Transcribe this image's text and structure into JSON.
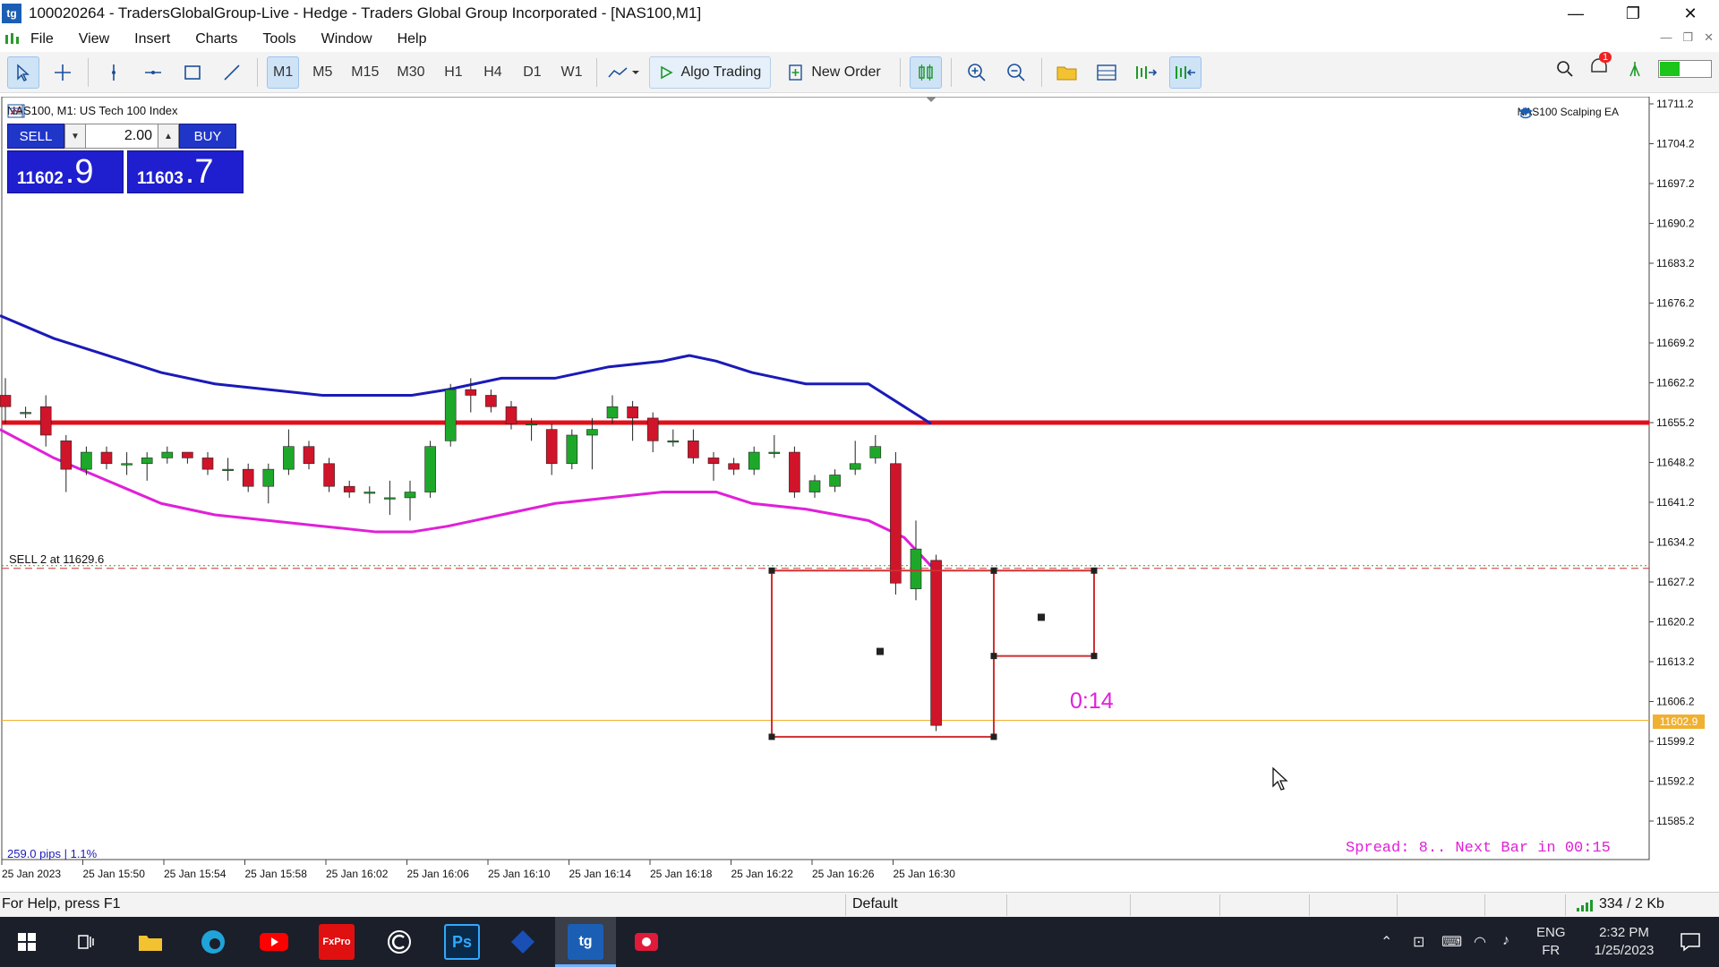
{
  "window": {
    "title": "100020264 - TradersGlobalGroup-Live - Hedge - Traders Global Group Incorporated - [NAS100,M1]",
    "logo_text": "tg",
    "minimize": "—",
    "restore": "❐",
    "close": "✕"
  },
  "menu": {
    "items": [
      "File",
      "View",
      "Insert",
      "Charts",
      "Tools",
      "Window",
      "Help"
    ]
  },
  "toolbar": {
    "timeframes": [
      "M1",
      "M5",
      "M15",
      "M30",
      "H1",
      "H4",
      "D1",
      "W1"
    ],
    "active_timeframe": "M1",
    "algo_trading": "Algo Trading",
    "new_order": "New Order",
    "notification_count": "1"
  },
  "chart": {
    "symbol_header": "NAS100, M1:  US Tech 100 Index",
    "ea_name": "NAS100 Scalping EA",
    "order_line_label": "SELL 2 at 11629.6",
    "countdown": "0:14",
    "pips_label": "259.0 pips | 1.1%",
    "spread_text": "Spread: 8.. Next Bar in 00:15",
    "current_price_label": "11602.9",
    "colors": {
      "up_candle": "#1ea82a",
      "down_candle": "#d0142a",
      "upper_band": "#1a1ab8",
      "lower_band": "#e020d8",
      "horizontal_line": "#e0101a",
      "rectangle": "#d03030",
      "bid_line": "#f0b030",
      "countdown": "#e020d8"
    }
  },
  "trade_panel": {
    "sell_label": "SELL",
    "buy_label": "BUY",
    "lot": "2.00",
    "bid_big": "11602",
    "bid_huge": ".9",
    "ask_big": "11603",
    "ask_huge": ".7"
  },
  "chart_data": {
    "type": "candlestick",
    "y_ticks": [
      "11711.2",
      "11704.2",
      "11697.2",
      "11690.2",
      "11683.2",
      "11676.2",
      "11669.2",
      "11662.2",
      "11655.2",
      "11648.2",
      "11641.2",
      "11634.2",
      "11627.2",
      "11620.2",
      "11613.2",
      "11606.2",
      "11599.2",
      "11592.2",
      "11585.2"
    ],
    "x_ticks": [
      "25 Jan 2023",
      "25 Jan 15:50",
      "25 Jan 15:54",
      "25 Jan 15:58",
      "25 Jan 16:02",
      "25 Jan 16:06",
      "25 Jan 16:10",
      "25 Jan 16:14",
      "25 Jan 16:18",
      "25 Jan 16:22",
      "25 Jan 16:26",
      "25 Jan 16:30"
    ],
    "ylim": [
      11580,
      11715
    ],
    "horizontal_line": 11655.2,
    "sell_order_level": 11629.6,
    "bid": 11602.9,
    "candles": [
      {
        "o": 11660,
        "c": 11658,
        "h": 11663,
        "l": 11655
      },
      {
        "o": 11657,
        "c": 11657,
        "h": 11658,
        "l": 11656
      },
      {
        "o": 11658,
        "c": 11653,
        "h": 11660,
        "l": 11651
      },
      {
        "o": 11652,
        "c": 11647,
        "h": 11653,
        "l": 11643
      },
      {
        "o": 11647,
        "c": 11650,
        "h": 11651,
        "l": 11646
      },
      {
        "o": 11650,
        "c": 11648,
        "h": 11651,
        "l": 11647
      },
      {
        "o": 11648,
        "c": 11648,
        "h": 11650,
        "l": 11646
      },
      {
        "o": 11648,
        "c": 11649,
        "h": 11650,
        "l": 11645
      },
      {
        "o": 11649,
        "c": 11650,
        "h": 11651,
        "l": 11648
      },
      {
        "o": 11650,
        "c": 11649,
        "h": 11650,
        "l": 11648
      },
      {
        "o": 11649,
        "c": 11647,
        "h": 11650,
        "l": 11646
      },
      {
        "o": 11647,
        "c": 11647,
        "h": 11649,
        "l": 11645
      },
      {
        "o": 11647,
        "c": 11644,
        "h": 11648,
        "l": 11643
      },
      {
        "o": 11644,
        "c": 11647,
        "h": 11648,
        "l": 11641
      },
      {
        "o": 11647,
        "c": 11651,
        "h": 11654,
        "l": 11646
      },
      {
        "o": 11651,
        "c": 11648,
        "h": 11652,
        "l": 11647
      },
      {
        "o": 11648,
        "c": 11644,
        "h": 11649,
        "l": 11643
      },
      {
        "o": 11644,
        "c": 11643,
        "h": 11645,
        "l": 11642
      },
      {
        "o": 11643,
        "c": 11643,
        "h": 11644,
        "l": 11641
      },
      {
        "o": 11642,
        "c": 11642,
        "h": 11645,
        "l": 11639
      },
      {
        "o": 11642,
        "c": 11643,
        "h": 11645,
        "l": 11638
      },
      {
        "o": 11643,
        "c": 11651,
        "h": 11652,
        "l": 11642
      },
      {
        "o": 11652,
        "c": 11661,
        "h": 11662,
        "l": 11651
      },
      {
        "o": 11661,
        "c": 11660,
        "h": 11663,
        "l": 11657
      },
      {
        "o": 11660,
        "c": 11658,
        "h": 11661,
        "l": 11657
      },
      {
        "o": 11658,
        "c": 11655,
        "h": 11659,
        "l": 11654
      },
      {
        "o": 11655,
        "c": 11655,
        "h": 11656,
        "l": 11652
      },
      {
        "o": 11654,
        "c": 11648,
        "h": 11655,
        "l": 11646
      },
      {
        "o": 11648,
        "c": 11653,
        "h": 11654,
        "l": 11647
      },
      {
        "o": 11653,
        "c": 11654,
        "h": 11656,
        "l": 11647
      },
      {
        "o": 11656,
        "c": 11658,
        "h": 11660,
        "l": 11655
      },
      {
        "o": 11658,
        "c": 11656,
        "h": 11659,
        "l": 11652
      },
      {
        "o": 11656,
        "c": 11652,
        "h": 11657,
        "l": 11650
      },
      {
        "o": 11652,
        "c": 11652,
        "h": 11654,
        "l": 11651
      },
      {
        "o": 11652,
        "c": 11649,
        "h": 11654,
        "l": 11648
      },
      {
        "o": 11649,
        "c": 11648,
        "h": 11650,
        "l": 11645
      },
      {
        "o": 11648,
        "c": 11647,
        "h": 11649,
        "l": 11646
      },
      {
        "o": 11647,
        "c": 11650,
        "h": 11651,
        "l": 11646
      },
      {
        "o": 11650,
        "c": 11650,
        "h": 11653,
        "l": 11649
      },
      {
        "o": 11650,
        "c": 11643,
        "h": 11651,
        "l": 11642
      },
      {
        "o": 11643,
        "c": 11645,
        "h": 11646,
        "l": 11642
      },
      {
        "o": 11644,
        "c": 11646,
        "h": 11647,
        "l": 11643
      },
      {
        "o": 11647,
        "c": 11648,
        "h": 11652,
        "l": 11646
      },
      {
        "o": 11649,
        "c": 11651,
        "h": 11653,
        "l": 11648
      },
      {
        "o": 11648,
        "c": 11627,
        "h": 11650,
        "l": 11625
      },
      {
        "o": 11626,
        "c": 11633,
        "h": 11638,
        "l": 11624
      },
      {
        "o": 11631,
        "c": 11602,
        "h": 11632,
        "l": 11601
      }
    ],
    "upper_band": [
      [
        0,
        11674
      ],
      [
        60,
        11670
      ],
      [
        120,
        11667
      ],
      [
        180,
        11664
      ],
      [
        240,
        11662
      ],
      [
        300,
        11661
      ],
      [
        360,
        11660
      ],
      [
        420,
        11660
      ],
      [
        460,
        11660
      ],
      [
        500,
        11661
      ],
      [
        560,
        11663
      ],
      [
        620,
        11663
      ],
      [
        680,
        11665
      ],
      [
        740,
        11666
      ],
      [
        770,
        11667
      ],
      [
        800,
        11666
      ],
      [
        840,
        11664
      ],
      [
        900,
        11662
      ],
      [
        970,
        11662
      ],
      [
        1010,
        11658
      ],
      [
        1040,
        11655
      ]
    ],
    "lower_band": [
      [
        0,
        11654
      ],
      [
        60,
        11649
      ],
      [
        120,
        11645
      ],
      [
        180,
        11641
      ],
      [
        240,
        11639
      ],
      [
        300,
        11638
      ],
      [
        360,
        11637
      ],
      [
        420,
        11636
      ],
      [
        460,
        11636
      ],
      [
        500,
        11637
      ],
      [
        560,
        11639
      ],
      [
        620,
        11641
      ],
      [
        680,
        11642
      ],
      [
        740,
        11643
      ],
      [
        770,
        11643
      ],
      [
        800,
        11643
      ],
      [
        840,
        11641
      ],
      [
        900,
        11640
      ],
      [
        970,
        11638
      ],
      [
        1010,
        11635
      ],
      [
        1040,
        11630
      ]
    ],
    "rectangles": [
      {
        "x1": 862,
        "x2": 1110,
        "y1": 11629.2,
        "y2": 11600
      },
      {
        "x1": 1110,
        "x2": 1222,
        "y1": 11629.2,
        "y2": 11614.2
      }
    ],
    "points": [
      {
        "x": 983,
        "y": 11615
      },
      {
        "x": 1163,
        "y": 11621
      }
    ]
  },
  "statusbar": {
    "help": "For Help, press F1",
    "profile": "Default",
    "traffic": "334 / 2 Kb"
  },
  "taskbar": {
    "lang_top": "ENG",
    "lang_bottom": "FR",
    "time": "2:32 PM",
    "date": "1/25/2023"
  }
}
